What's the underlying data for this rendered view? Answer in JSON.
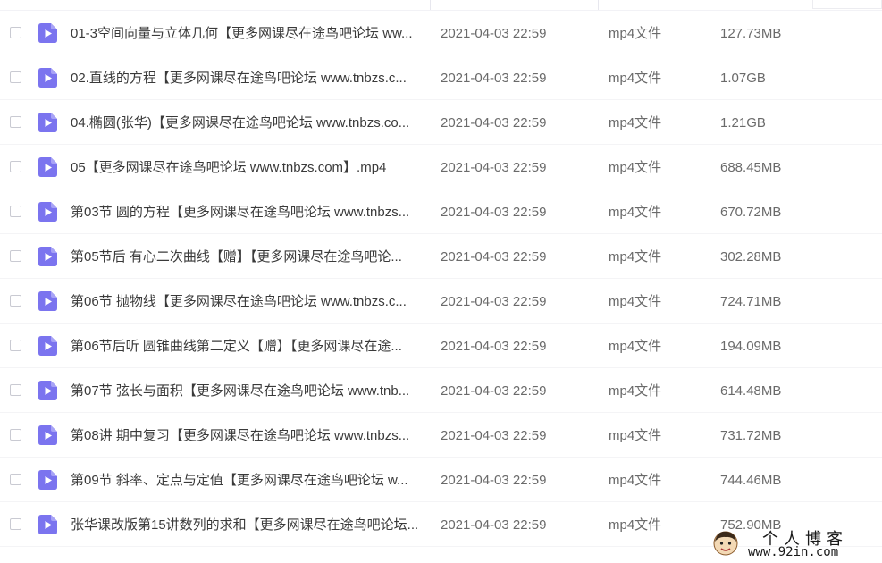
{
  "colors": {
    "file_icon": "#7b74ef",
    "checkbox_border": "#c9cad2"
  },
  "file_icon_name": "video-file-icon",
  "files": [
    {
      "name": "01-3空间向量与立体几何【更多网课尽在途鸟吧论坛 ww...",
      "date": "2021-04-03 22:59",
      "type": "mp4文件",
      "size": "127.73MB"
    },
    {
      "name": "02.直线的方程【更多网课尽在途鸟吧论坛 www.tnbzs.c...",
      "date": "2021-04-03 22:59",
      "type": "mp4文件",
      "size": "1.07GB"
    },
    {
      "name": "04.椭圆(张华)【更多网课尽在途鸟吧论坛 www.tnbzs.co...",
      "date": "2021-04-03 22:59",
      "type": "mp4文件",
      "size": "1.21GB"
    },
    {
      "name": "05【更多网课尽在途鸟吧论坛 www.tnbzs.com】.mp4",
      "date": "2021-04-03 22:59",
      "type": "mp4文件",
      "size": "688.45MB"
    },
    {
      "name": "第03节 圆的方程【更多网课尽在途鸟吧论坛 www.tnbzs...",
      "date": "2021-04-03 22:59",
      "type": "mp4文件",
      "size": "670.72MB"
    },
    {
      "name": "第05节后 有心二次曲线【赠】【更多网课尽在途鸟吧论...",
      "date": "2021-04-03 22:59",
      "type": "mp4文件",
      "size": "302.28MB"
    },
    {
      "name": "第06节 抛物线【更多网课尽在途鸟吧论坛 www.tnbzs.c...",
      "date": "2021-04-03 22:59",
      "type": "mp4文件",
      "size": "724.71MB"
    },
    {
      "name": "第06节后听 圆锥曲线第二定义【赠】【更多网课尽在途...",
      "date": "2021-04-03 22:59",
      "type": "mp4文件",
      "size": "194.09MB"
    },
    {
      "name": "第07节 弦长与面积【更多网课尽在途鸟吧论坛 www.tnb...",
      "date": "2021-04-03 22:59",
      "type": "mp4文件",
      "size": "614.48MB"
    },
    {
      "name": "第08讲 期中复习【更多网课尽在途鸟吧论坛 www.tnbzs...",
      "date": "2021-04-03 22:59",
      "type": "mp4文件",
      "size": "731.72MB"
    },
    {
      "name": "第09节 斜率、定点与定值【更多网课尽在途鸟吧论坛 w...",
      "date": "2021-04-03 22:59",
      "type": "mp4文件",
      "size": "744.46MB"
    },
    {
      "name": "张华课改版第15讲数列的求和【更多网课尽在途鸟吧论坛...",
      "date": "2021-04-03 22:59",
      "type": "mp4文件",
      "size": "752.90MB"
    }
  ],
  "watermark": {
    "title": "个人博客",
    "url": "www.92in.com"
  }
}
